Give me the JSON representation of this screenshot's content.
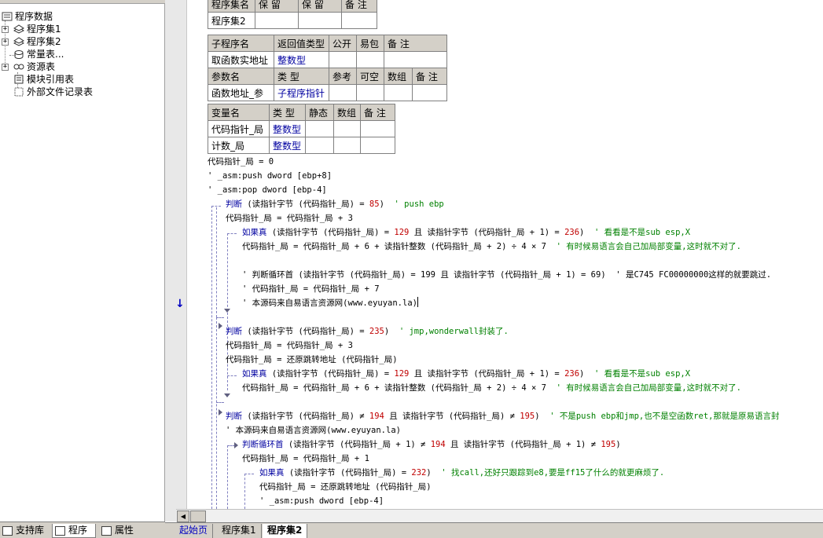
{
  "tree": {
    "root": "程序数据",
    "items": [
      "程序集1",
      "程序集2",
      "常量表...",
      "资源表",
      "模块引用表",
      "外部文件记录表"
    ]
  },
  "left_tabs": [
    "支持库",
    "程序",
    "属性"
  ],
  "doc_tabs": [
    "起始页",
    "程序集1",
    "程序集2"
  ],
  "table1": {
    "headers": [
      "程序集名",
      "保 留",
      "保 留",
      "备 注"
    ],
    "row": [
      "程序集2",
      "",
      "",
      ""
    ]
  },
  "table2": {
    "headers": [
      "子程序名",
      "返回值类型",
      "公开",
      "易包",
      "备 注"
    ],
    "row": [
      "取函数实地址",
      "整数型",
      "",
      "",
      ""
    ],
    "param_headers": [
      "参数名",
      "类 型",
      "参考",
      "可空",
      "数组",
      "备 注"
    ],
    "param_row": [
      "函数地址_参",
      "子程序指针",
      "",
      "",
      "",
      ""
    ]
  },
  "table3": {
    "headers": [
      "变量名",
      "类 型",
      "静态",
      "数组",
      "备 注"
    ],
    "rows": [
      [
        "代码指针_局",
        "整数型",
        "",
        "",
        ""
      ],
      [
        "计数_局",
        "整数型",
        "",
        "",
        ""
      ]
    ]
  },
  "code": {
    "l1": "代码指针_局 = 0",
    "l2": "' _asm:push dword [ebp+8]",
    "l3": "' _asm:pop dword [ebp-4]",
    "l4a": "判断",
    "l4b": " (读指针字节 (代码指针_局) = ",
    "l4n": "85",
    "l4c": ")  ",
    "l4d": "' push ebp",
    "l5": "代码指针_局 = 代码指针_局 + 3",
    "l6a": "如果真",
    "l6b": " (读指针字节 (代码指针_局) = ",
    "l6n": "129",
    "l6c": " 且 读指针字节 (代码指针_局 + 1) = ",
    "l6n2": "236",
    "l6d": ")  ",
    "l6e": "' 看看是不是sub esp,X",
    "l7a": "代码指针_局 = 代码指针_局 + 6 + 读指针整数 (代码指针_局 + 2) ÷ 4 × 7  ",
    "l7b": "' 有时候易语言会自己加局部变量,这时就不对了.",
    "l8a": "' 判断循环首 (读指针字节 (代码指针_局) = 199 且 读指针字节 (代码指针_局 + 1) = 69)  ",
    "l8b": "' 是C745 FC00000000这样的就要跳过.",
    "l9": "' 代码指针_局 = 代码指针_局 + 7",
    "l10": "' 本源码来自易语言资源网(www.eyuyan.la)",
    "l11a": "判断",
    "l11b": " (读指针字节 (代码指针_局) = ",
    "l11n": "235",
    "l11c": ")  ",
    "l11d": "' jmp,wonderwall封装了.",
    "l12": "代码指针_局 = 代码指针_局 + 3",
    "l13": "代码指针_局 = 还原跳转地址 (代码指针_局)",
    "l14a": "如果真",
    "l14b": " (读指针字节 (代码指针_局) = ",
    "l14n": "129",
    "l14c": " 且 读指针字节 (代码指针_局 + 1) = ",
    "l14n2": "236",
    "l14d": ")  ",
    "l14e": "' 看看是不是sub esp,X",
    "l15a": "代码指针_局 = 代码指针_局 + 6 + 读指针整数 (代码指针_局 + 2) ÷ 4 × 7  ",
    "l15b": "' 有时候易语言会自己加局部变量,这时就不对了.",
    "l16a": "判断",
    "l16b": " (读指针字节 (代码指针_局) ≠ ",
    "l16n": "194",
    "l16c": " 且 读指针字节 (代码指针_局) ≠ ",
    "l16n2": "195",
    "l16d": ")  ",
    "l16e": "' 不是push ebp和jmp,也不是空函数ret,那就是原易语言封",
    "l17": "' 本源码来自易语言资源网(www.eyuyan.la)",
    "l18a": "判断循环首",
    "l18b": " (读指针字节 (代码指针_局 + 1) ≠ ",
    "l18n": "194",
    "l18c": " 且 读指针字节 (代码指针_局 + 1) ≠ ",
    "l18n2": "195",
    "l18d": ")",
    "l19": "代码指针_局 = 代码指针_局 + 1",
    "l20a": "如果真",
    "l20b": " (读指针字节 (代码指针_局) = ",
    "l20n": "232",
    "l20c": ")  ",
    "l20d": "' 找call,还好只跟踪到e8,要是ff15了什么的就更麻烦了.",
    "l21": "代码指针_局 = 还原跳转地址 (代码指针_局)",
    "l22": "' _asm:push dword [ebp-4]"
  }
}
